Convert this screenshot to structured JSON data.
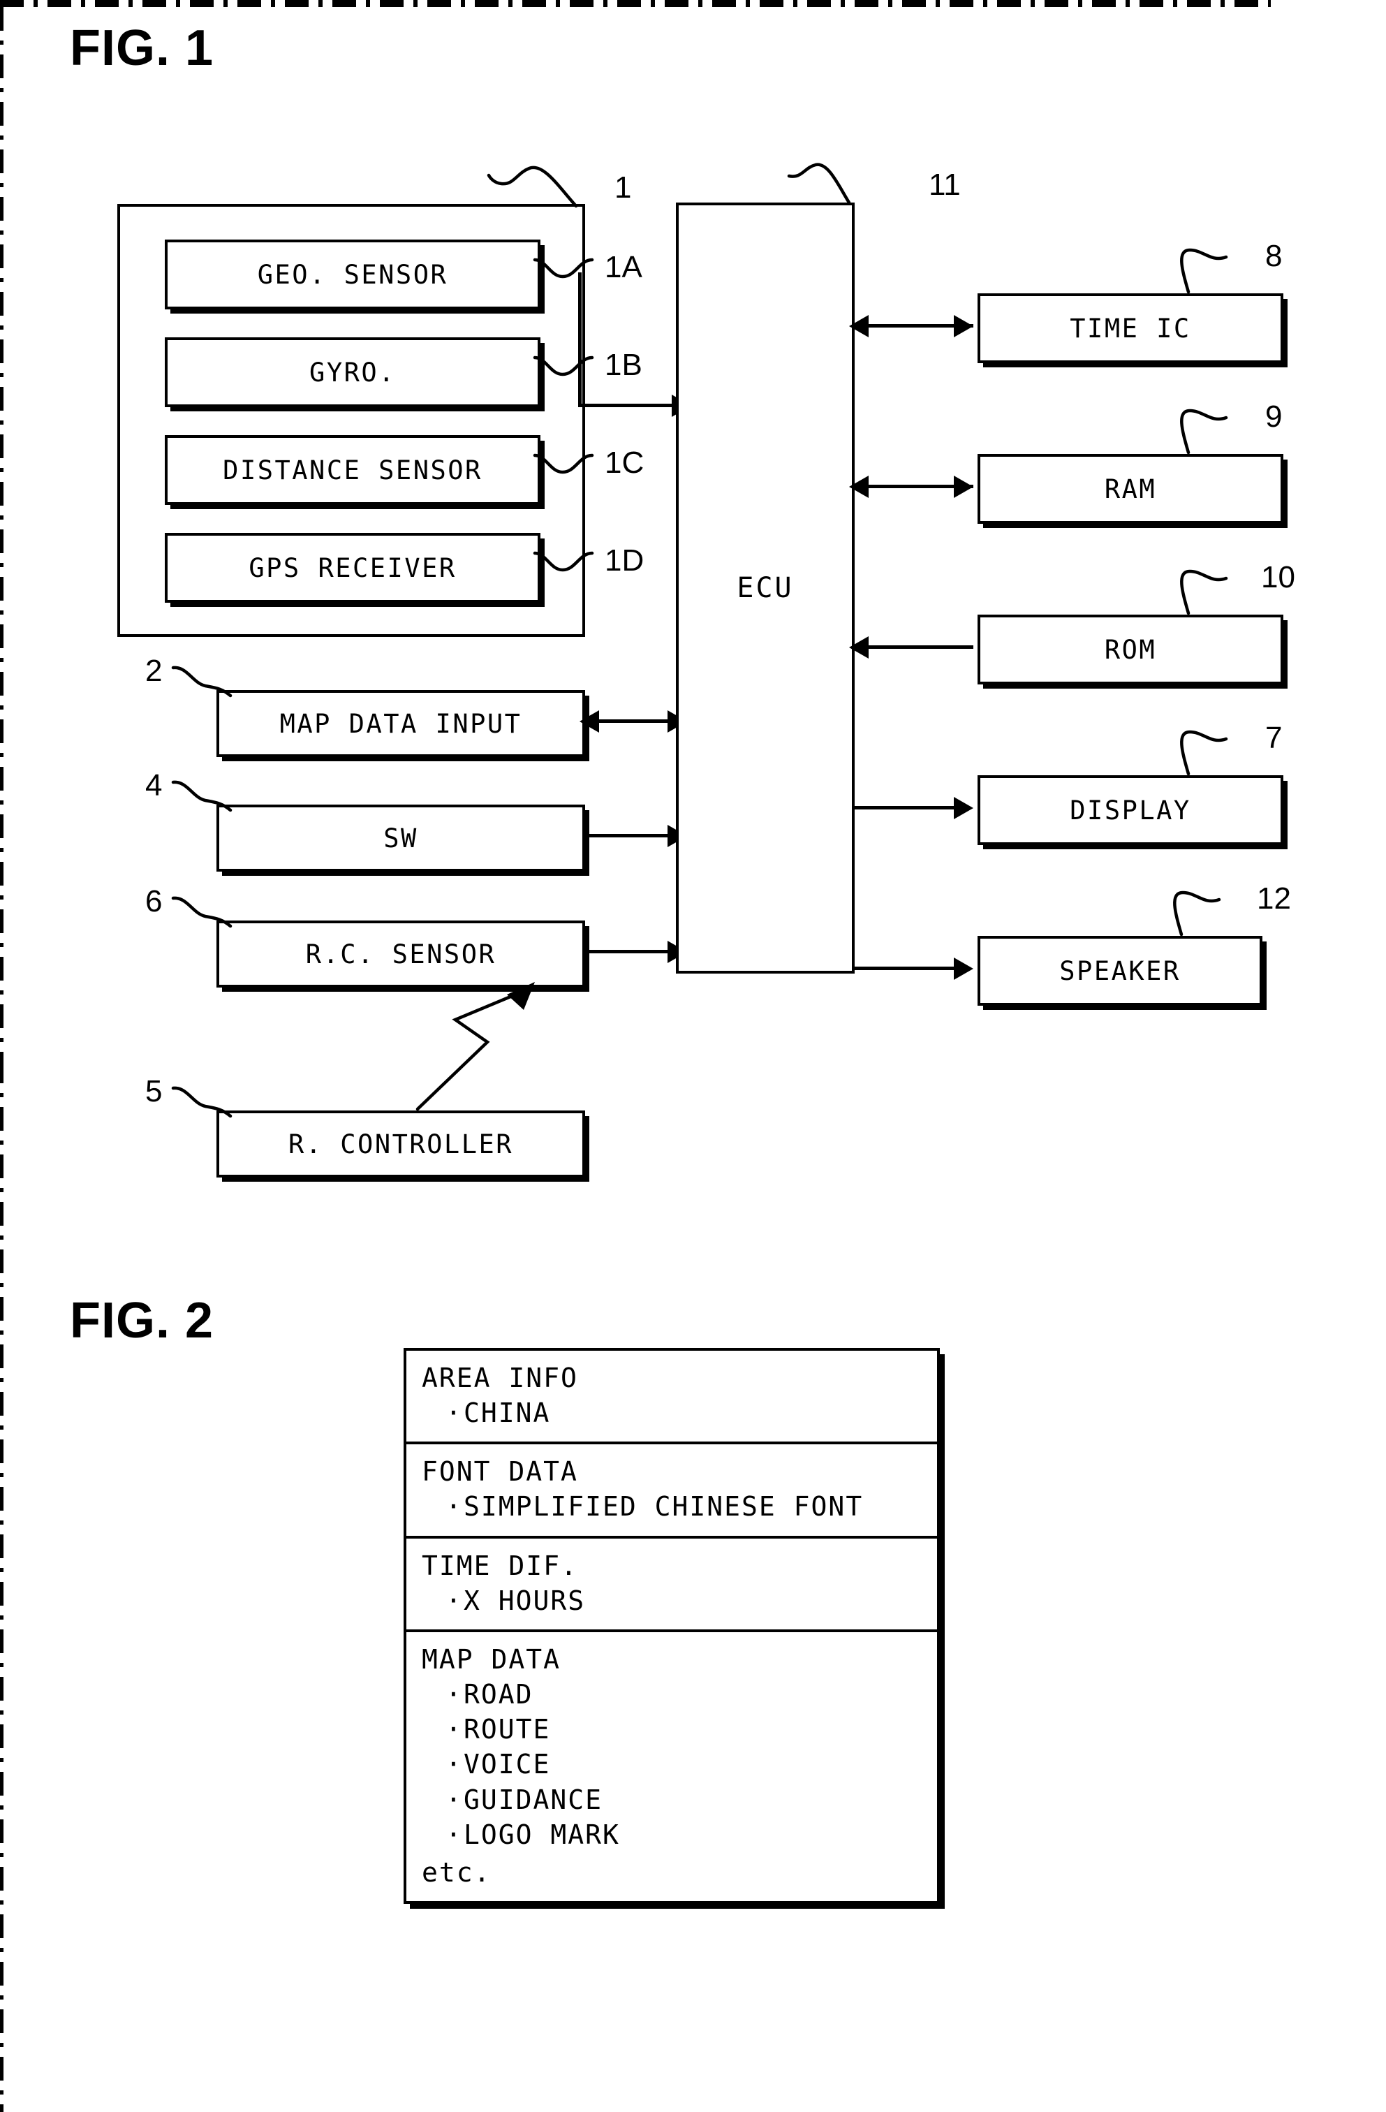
{
  "figures": {
    "fig1_title": "FIG. 1",
    "fig2_title": "FIG. 2"
  },
  "fig1": {
    "sensor_group": {
      "ref": "1",
      "items": [
        {
          "label": "GEO. SENSOR",
          "ref": "1A"
        },
        {
          "label": "GYRO.",
          "ref": "1B"
        },
        {
          "label": "DISTANCE SENSOR",
          "ref": "1C"
        },
        {
          "label": "GPS RECEIVER",
          "ref": "1D"
        }
      ]
    },
    "left_blocks": [
      {
        "label": "MAP DATA INPUT",
        "ref": "2",
        "arrow": "bidirectional"
      },
      {
        "label": "SW",
        "ref": "4",
        "arrow": "to-ecu"
      },
      {
        "label": "R.C. SENSOR",
        "ref": "6",
        "arrow": "to-ecu"
      },
      {
        "label": "R. CONTROLLER",
        "ref": "5",
        "arrow": "zigzag-to-rc-sensor"
      }
    ],
    "ecu": {
      "label": "ECU",
      "ref": "11"
    },
    "right_blocks": [
      {
        "label": "TIME IC",
        "ref": "8",
        "arrow": "bidirectional"
      },
      {
        "label": "RAM",
        "ref": "9",
        "arrow": "bidirectional"
      },
      {
        "label": "ROM",
        "ref": "10",
        "arrow": "to-ecu"
      },
      {
        "label": "DISPLAY",
        "ref": "7",
        "arrow": "from-ecu"
      },
      {
        "label": "SPEAKER",
        "ref": "12",
        "arrow": "from-ecu"
      }
    ]
  },
  "fig2": {
    "sections": [
      {
        "heading": "AREA INFO",
        "items": [
          "CHINA"
        ]
      },
      {
        "heading": "FONT DATA",
        "items": [
          "SIMPLIFIED CHINESE FONT"
        ]
      },
      {
        "heading": "TIME DIF.",
        "items": [
          "X HOURS"
        ]
      },
      {
        "heading": "MAP DATA",
        "items": [
          "ROAD",
          "ROUTE",
          "VOICE",
          "GUIDANCE",
          "LOGO MARK"
        ],
        "footer": "etc."
      }
    ]
  },
  "colors": {
    "ink": "#000000",
    "paper": "#ffffff"
  }
}
